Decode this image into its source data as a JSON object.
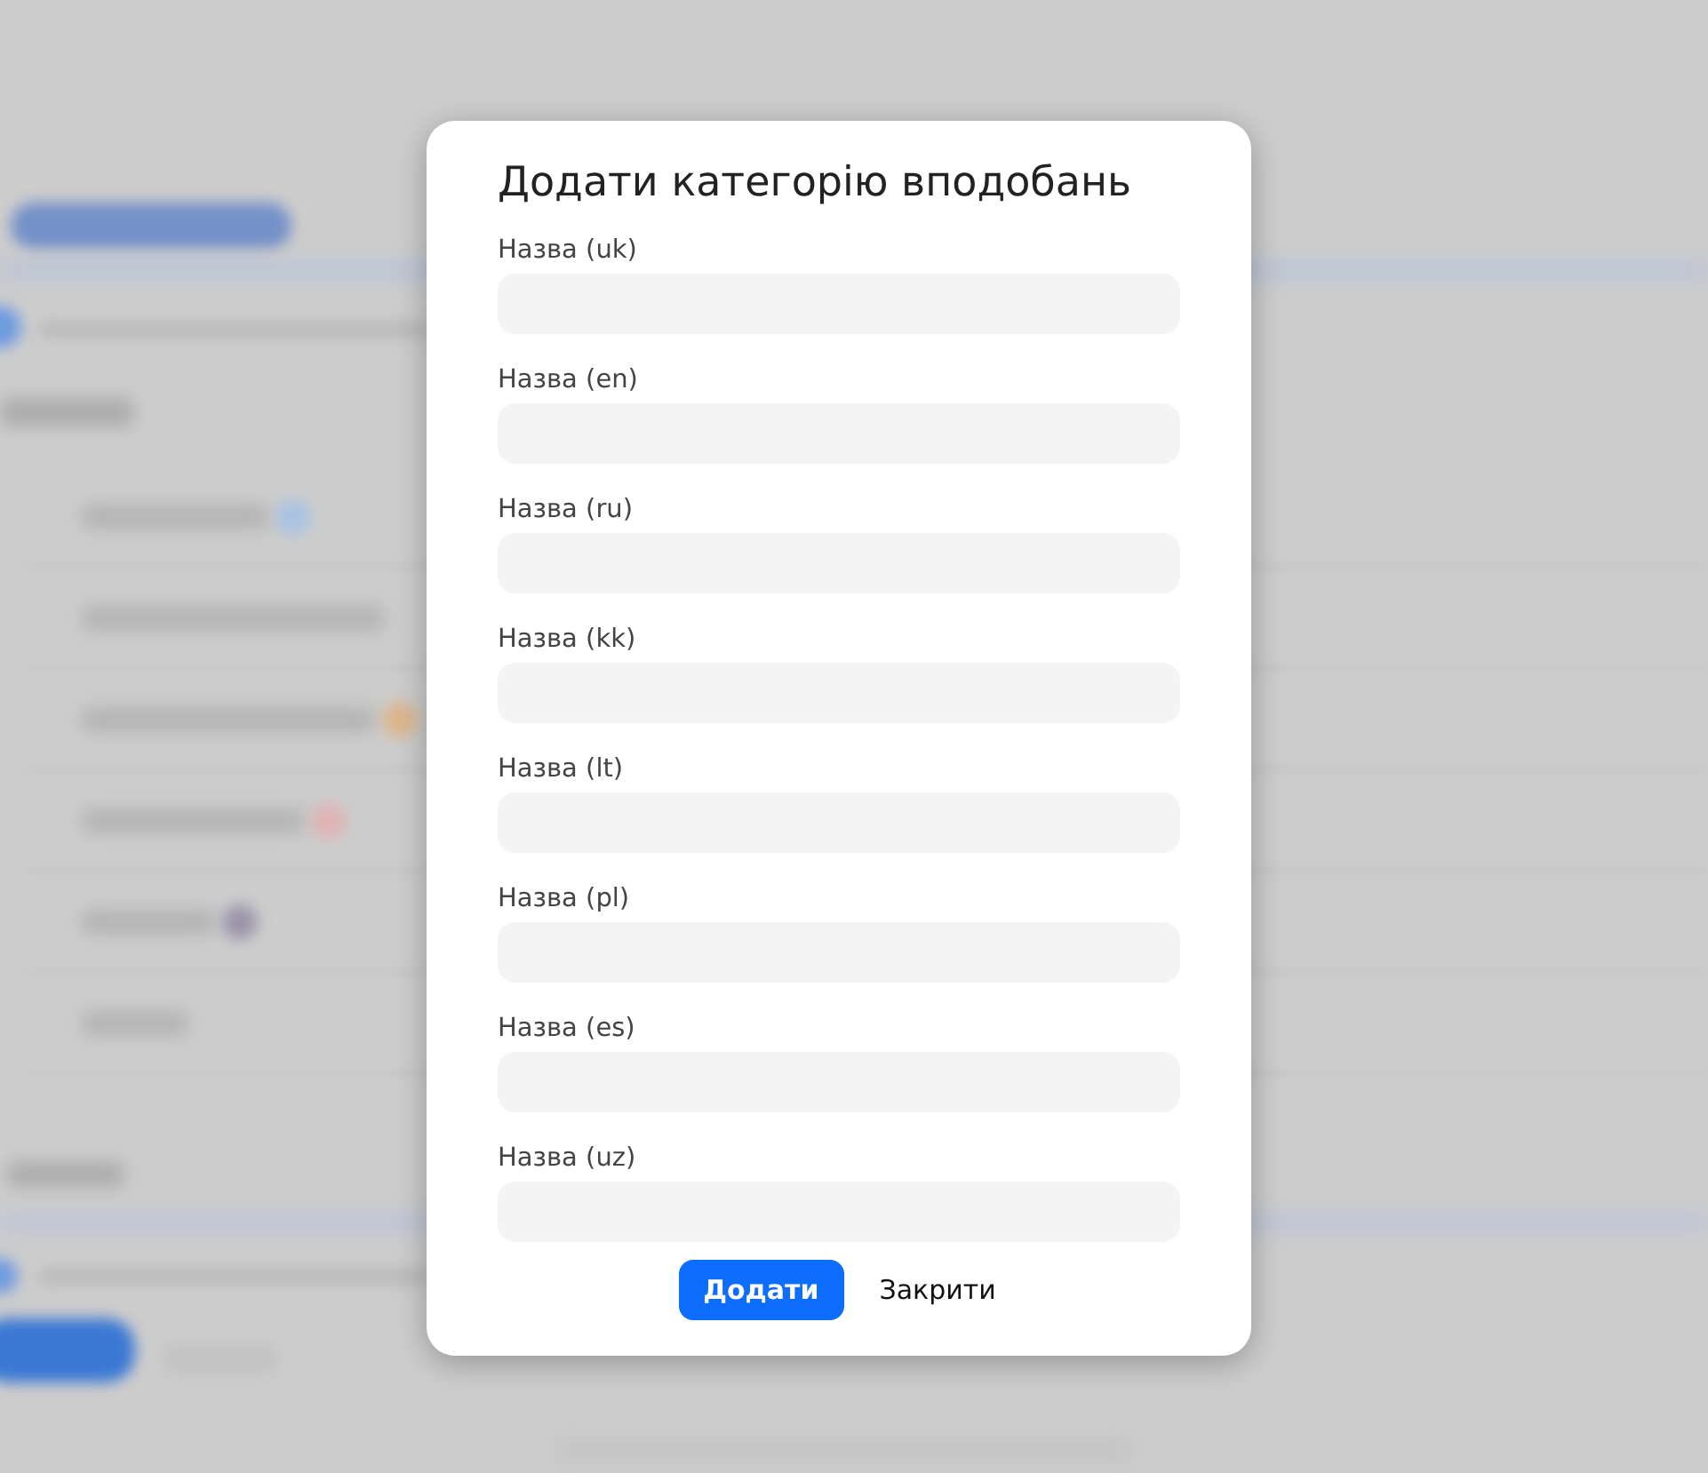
{
  "dialog": {
    "title": "Додати категорію вподобань",
    "fields": [
      {
        "label": "Назва (uk)"
      },
      {
        "label": "Назва (en)"
      },
      {
        "label": "Назва (ru)"
      },
      {
        "label": "Назва (kk)"
      },
      {
        "label": "Назва (lt)"
      },
      {
        "label": "Назва (pl)"
      },
      {
        "label": "Назва (es)"
      },
      {
        "label": "Назва (uz)"
      }
    ],
    "buttons": [
      {
        "label": "Додати",
        "kind": "primary"
      },
      {
        "label": "Закрити",
        "kind": "plain"
      }
    ]
  }
}
